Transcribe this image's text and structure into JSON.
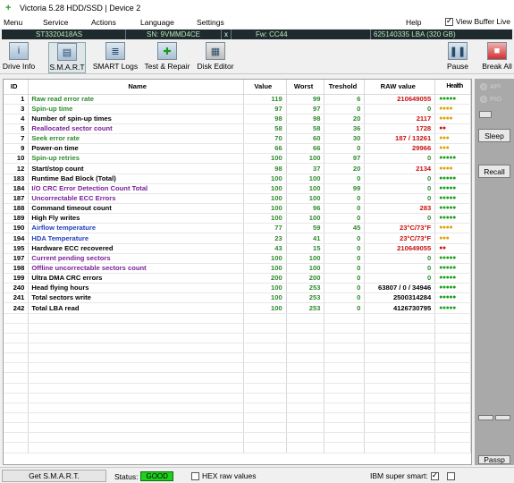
{
  "window": {
    "title": "Victoria 5.28 HDD/SSD | Device 2"
  },
  "menu": {
    "items": [
      "Menu",
      "Service",
      "Actions",
      "Language",
      "Settings",
      "Help"
    ],
    "view_buffer": "View Buffer Live"
  },
  "device": {
    "model": "ST3320418AS",
    "serial": "SN: 9VMMD4CE",
    "close": "x",
    "firmware": "Fw: CC44",
    "size": "625140335 LBA (320 GB)"
  },
  "toolbar": {
    "drive_info": "Drive Info",
    "smart": "S.M.A.R.T",
    "smart_logs": "SMART Logs",
    "test_repair": "Test & Repair",
    "disk_editor": "Disk Editor",
    "pause": "Pause",
    "break_all": "Break All"
  },
  "table": {
    "headers": {
      "id": "ID",
      "name": "Name",
      "value": "Value",
      "worst": "Worst",
      "threshold": "Treshold",
      "raw": "RAW value",
      "health": "Health"
    },
    "rows": [
      {
        "id": "1",
        "name": "Raw read error rate",
        "value": "119",
        "worst": "99",
        "threshold": "6",
        "raw": "210649055",
        "health": "●●●●●",
        "health_color": "#1aa01a",
        "name_color": "green"
      },
      {
        "id": "3",
        "name": "Spin-up time",
        "value": "97",
        "worst": "97",
        "threshold": "0",
        "raw": "0",
        "health": "●●●●",
        "health_color": "#e0a000",
        "name_color": "green"
      },
      {
        "id": "4",
        "name": "Number of spin-up times",
        "value": "98",
        "worst": "98",
        "threshold": "20",
        "raw": "2117",
        "health": "●●●●",
        "health_color": "#e0a000",
        "name_color": "dark"
      },
      {
        "id": "5",
        "name": "Reallocated sector count",
        "value": "58",
        "worst": "58",
        "threshold": "36",
        "raw": "1728",
        "health": "●●",
        "health_color": "#d01010",
        "name_color": "purple"
      },
      {
        "id": "7",
        "name": "Seek error rate",
        "value": "70",
        "worst": "60",
        "threshold": "30",
        "raw": "187 / 13261",
        "health": "●●●",
        "health_color": "#e0a000",
        "name_color": "green"
      },
      {
        "id": "9",
        "name": "Power-on time",
        "value": "66",
        "worst": "66",
        "threshold": "0",
        "raw": "29966",
        "health": "●●●",
        "health_color": "#e0a000",
        "name_color": "dark"
      },
      {
        "id": "10",
        "name": "Spin-up retries",
        "value": "100",
        "worst": "100",
        "threshold": "97",
        "raw": "0",
        "health": "●●●●●",
        "health_color": "#1aa01a",
        "name_color": "green"
      },
      {
        "id": "12",
        "name": "Start/stop count",
        "value": "98",
        "worst": "37",
        "threshold": "20",
        "raw": "2134",
        "health": "●●●●",
        "health_color": "#e0a000",
        "name_color": "dark"
      },
      {
        "id": "183",
        "name": "Runtime Bad Block (Total)",
        "value": "100",
        "worst": "100",
        "threshold": "0",
        "raw": "0",
        "health": "●●●●●",
        "health_color": "#1aa01a",
        "name_color": "dark"
      },
      {
        "id": "184",
        "name": "I/O CRC Error Detection Count Total",
        "value": "100",
        "worst": "100",
        "threshold": "99",
        "raw": "0",
        "health": "●●●●●",
        "health_color": "#1aa01a",
        "name_color": "purple"
      },
      {
        "id": "187",
        "name": "Uncorrectable ECC Errors",
        "value": "100",
        "worst": "100",
        "threshold": "0",
        "raw": "0",
        "health": "●●●●●",
        "health_color": "#1aa01a",
        "name_color": "purple"
      },
      {
        "id": "188",
        "name": "Command timeout count",
        "value": "100",
        "worst": "96",
        "threshold": "0",
        "raw": "283",
        "health": "●●●●●",
        "health_color": "#1aa01a",
        "name_color": "dark"
      },
      {
        "id": "189",
        "name": "High Fly writes",
        "value": "100",
        "worst": "100",
        "threshold": "0",
        "raw": "0",
        "health": "●●●●●",
        "health_color": "#1aa01a",
        "name_color": "dark"
      },
      {
        "id": "190",
        "name": "Airflow temperature",
        "value": "77",
        "worst": "59",
        "threshold": "45",
        "raw": "23°C/73°F",
        "health": "●●●●",
        "health_color": "#e0a000",
        "name_color": "blue"
      },
      {
        "id": "194",
        "name": "HDA Temperature",
        "value": "23",
        "worst": "41",
        "threshold": "0",
        "raw": "23°C/73°F",
        "health": "●●●",
        "health_color": "#e0a000",
        "name_color": "blue"
      },
      {
        "id": "195",
        "name": "Hardware ECC recovered",
        "value": "43",
        "worst": "15",
        "threshold": "0",
        "raw": "210649055",
        "health": "●●",
        "health_color": "#d01010",
        "name_color": "dark"
      },
      {
        "id": "197",
        "name": "Current pending sectors",
        "value": "100",
        "worst": "100",
        "threshold": "0",
        "raw": "0",
        "health": "●●●●●",
        "health_color": "#1aa01a",
        "name_color": "purple"
      },
      {
        "id": "198",
        "name": "Offline uncorrectable sectors count",
        "value": "100",
        "worst": "100",
        "threshold": "0",
        "raw": "0",
        "health": "●●●●●",
        "health_color": "#1aa01a",
        "name_color": "purple"
      },
      {
        "id": "199",
        "name": "Ultra DMA CRC errors",
        "value": "200",
        "worst": "200",
        "threshold": "0",
        "raw": "0",
        "health": "●●●●●",
        "health_color": "#1aa01a",
        "name_color": "dark"
      },
      {
        "id": "240",
        "name": "Head flying hours",
        "value": "100",
        "worst": "253",
        "threshold": "0",
        "raw": "63807 / 0 / 34946",
        "health": "●●●●●",
        "health_color": "#1aa01a",
        "name_color": "dark"
      },
      {
        "id": "241",
        "name": "Total sectors write",
        "value": "100",
        "worst": "253",
        "threshold": "0",
        "raw": "2500314284",
        "health": "●●●●●",
        "health_color": "#1aa01a",
        "name_color": "dark"
      },
      {
        "id": "242",
        "name": "Total LBA read",
        "value": "100",
        "worst": "253",
        "threshold": "0",
        "raw": "4126730795",
        "health": "●●●●●",
        "health_color": "#1aa01a",
        "name_color": "dark"
      }
    ]
  },
  "right_panel": {
    "api": "API",
    "pio": "PIO",
    "sleep": "Sleep",
    "recall": "Recall",
    "passp": "Passp"
  },
  "status": {
    "get_smart": "Get S.M.A.R.T.",
    "status_label": "Status:",
    "status_value": "GOOD",
    "hex_raw": "HEX raw values",
    "ibm_super_smart": "IBM super smart:"
  },
  "colors": {
    "good": "#1fd01f",
    "device_bar": "#1f2a2f",
    "name_green": "#2d8a2d",
    "name_purple": "#7a1f9a",
    "name_blue": "#1f3fbf",
    "raw_red": "#c81010"
  }
}
